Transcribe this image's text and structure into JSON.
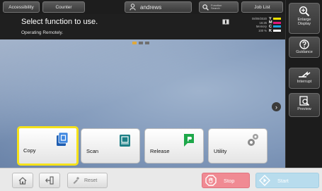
{
  "topbar": {
    "accessibility_label": "Accessibility",
    "counter_label": "Counter",
    "user_name": "andrews",
    "search_label_line1": "Function",
    "search_label_line2": "Search",
    "joblist_label": "Job List"
  },
  "header": {
    "title": "Select function to use.",
    "subtitle": "Operating Remotely.",
    "date": "08/09/2020",
    "time": "16:26",
    "memory_label": "Memory",
    "memory_value": "100 %"
  },
  "toner": [
    {
      "letter": "Y",
      "color": "#f2e200"
    },
    {
      "letter": "M",
      "color": "#e0177c"
    },
    {
      "letter": "C",
      "color": "#1aa3e0"
    },
    {
      "letter": "K",
      "color": "#ffffff"
    }
  ],
  "functions": [
    {
      "label": "Copy",
      "selected": true,
      "color": "#2a6fc9"
    },
    {
      "label": "Scan",
      "selected": false,
      "color": "#1e7f86"
    },
    {
      "label": "Release",
      "selected": false,
      "color": "#1ea84a"
    },
    {
      "label": "Utility",
      "selected": false,
      "color": "#8a8a8a"
    }
  ],
  "sidebar": {
    "enlarge_line1": "Enlarge",
    "enlarge_line2": "Display",
    "guidance": "Guidance",
    "interrupt": "Interrupt",
    "preview": "Preview"
  },
  "bottombar": {
    "reset": "Reset",
    "stop": "Stop",
    "start": "Start"
  },
  "colors": {
    "selection_highlight": "#f5e21a",
    "stop_button": "#f08a93",
    "start_button": "#b8dced"
  },
  "icons": [
    "accessibility",
    "user-icon",
    "search-icon",
    "zoom-icon",
    "help-icon",
    "interrupt-icon",
    "preview-icon",
    "home-icon",
    "logout-icon",
    "reset-icon",
    "stop-icon",
    "start-icon",
    "gear-icon"
  ]
}
